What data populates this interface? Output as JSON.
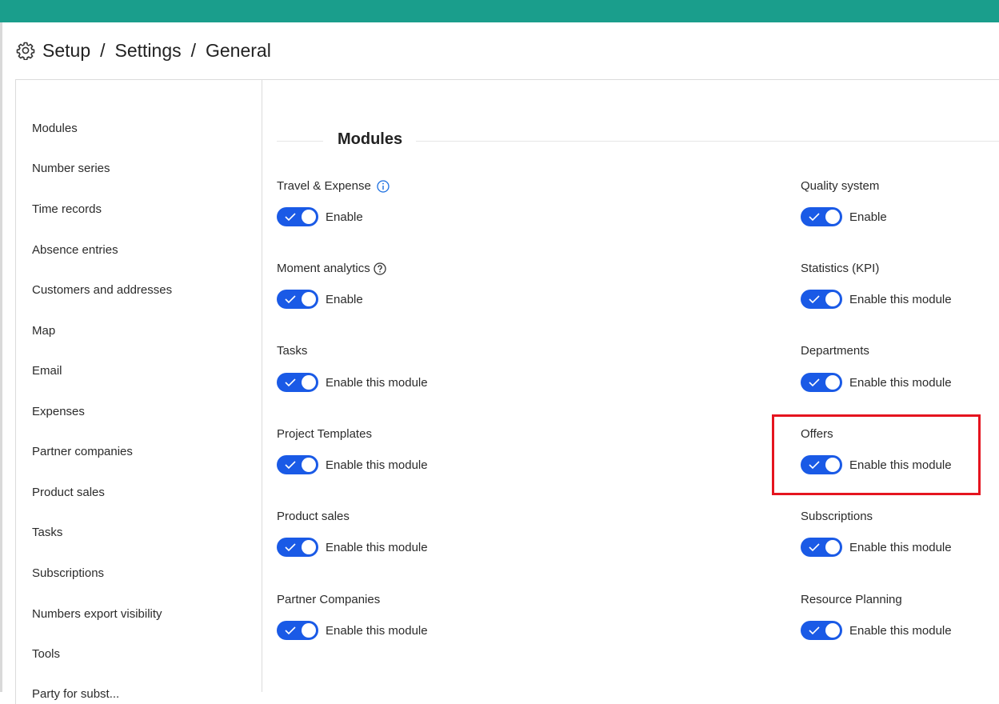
{
  "colors": {
    "topbar": "#1a9e8c",
    "toggle_on": "#1a5ae6",
    "info_icon": "#1a6ee0",
    "highlight": "#e5141f"
  },
  "breadcrumb": {
    "icon": "gear-icon",
    "items": [
      "Setup",
      "Settings",
      "General"
    ],
    "separator": "/"
  },
  "sidebar": {
    "items": [
      "Modules",
      "Number series",
      "Time records",
      "Absence entries",
      "Customers and addresses",
      "Map",
      "Email",
      "Expenses",
      "Partner companies",
      "Product sales",
      "Tasks",
      "Subscriptions",
      "Numbers export visibility",
      "Tools",
      "Party for subst..."
    ]
  },
  "main": {
    "section_title": "Modules",
    "left": [
      {
        "label": "Travel & Expense",
        "icon": "info-icon",
        "toggle": "Enable",
        "on": true
      },
      {
        "label": "Moment analytics",
        "icon": "help-icon",
        "toggle": "Enable",
        "on": true
      },
      {
        "label": "Tasks",
        "toggle": "Enable this module",
        "on": true
      },
      {
        "label": "Project Templates",
        "toggle": "Enable this module",
        "on": true
      },
      {
        "label": "Product sales",
        "toggle": "Enable this module",
        "on": true
      },
      {
        "label": "Partner Companies",
        "toggle": "Enable this module",
        "on": true
      }
    ],
    "right": [
      {
        "label": "Quality system",
        "toggle": "Enable",
        "on": true
      },
      {
        "label": "Statistics (KPI)",
        "toggle": "Enable this module",
        "on": true
      },
      {
        "label": "Departments",
        "toggle": "Enable this module",
        "on": true
      },
      {
        "label": "Offers",
        "toggle": "Enable this module",
        "on": true,
        "highlighted": true
      },
      {
        "label": "Subscriptions",
        "toggle": "Enable this module",
        "on": true
      },
      {
        "label": "Resource Planning",
        "toggle": "Enable this module",
        "on": true
      }
    ]
  }
}
